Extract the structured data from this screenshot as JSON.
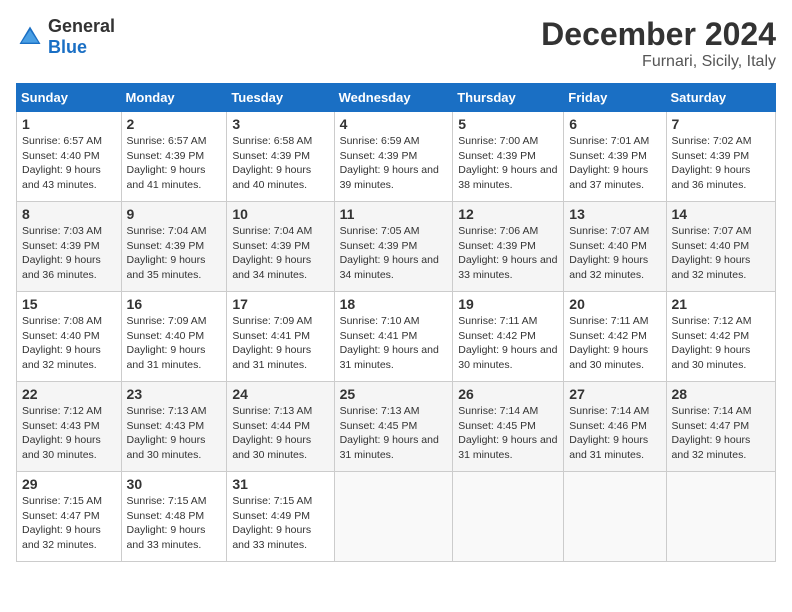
{
  "header": {
    "logo_general": "General",
    "logo_blue": "Blue",
    "title": "December 2024",
    "subtitle": "Furnari, Sicily, Italy"
  },
  "calendar": {
    "columns": [
      "Sunday",
      "Monday",
      "Tuesday",
      "Wednesday",
      "Thursday",
      "Friday",
      "Saturday"
    ],
    "rows": [
      [
        {
          "day": "1",
          "sunrise": "6:57 AM",
          "sunset": "4:40 PM",
          "daylight": "9 hours and 43 minutes."
        },
        {
          "day": "2",
          "sunrise": "6:57 AM",
          "sunset": "4:39 PM",
          "daylight": "9 hours and 41 minutes."
        },
        {
          "day": "3",
          "sunrise": "6:58 AM",
          "sunset": "4:39 PM",
          "daylight": "9 hours and 40 minutes."
        },
        {
          "day": "4",
          "sunrise": "6:59 AM",
          "sunset": "4:39 PM",
          "daylight": "9 hours and 39 minutes."
        },
        {
          "day": "5",
          "sunrise": "7:00 AM",
          "sunset": "4:39 PM",
          "daylight": "9 hours and 38 minutes."
        },
        {
          "day": "6",
          "sunrise": "7:01 AM",
          "sunset": "4:39 PM",
          "daylight": "9 hours and 37 minutes."
        },
        {
          "day": "7",
          "sunrise": "7:02 AM",
          "sunset": "4:39 PM",
          "daylight": "9 hours and 36 minutes."
        }
      ],
      [
        {
          "day": "8",
          "sunrise": "7:03 AM",
          "sunset": "4:39 PM",
          "daylight": "9 hours and 36 minutes."
        },
        {
          "day": "9",
          "sunrise": "7:04 AM",
          "sunset": "4:39 PM",
          "daylight": "9 hours and 35 minutes."
        },
        {
          "day": "10",
          "sunrise": "7:04 AM",
          "sunset": "4:39 PM",
          "daylight": "9 hours and 34 minutes."
        },
        {
          "day": "11",
          "sunrise": "7:05 AM",
          "sunset": "4:39 PM",
          "daylight": "9 hours and 34 minutes."
        },
        {
          "day": "12",
          "sunrise": "7:06 AM",
          "sunset": "4:39 PM",
          "daylight": "9 hours and 33 minutes."
        },
        {
          "day": "13",
          "sunrise": "7:07 AM",
          "sunset": "4:40 PM",
          "daylight": "9 hours and 32 minutes."
        },
        {
          "day": "14",
          "sunrise": "7:07 AM",
          "sunset": "4:40 PM",
          "daylight": "9 hours and 32 minutes."
        }
      ],
      [
        {
          "day": "15",
          "sunrise": "7:08 AM",
          "sunset": "4:40 PM",
          "daylight": "9 hours and 32 minutes."
        },
        {
          "day": "16",
          "sunrise": "7:09 AM",
          "sunset": "4:40 PM",
          "daylight": "9 hours and 31 minutes."
        },
        {
          "day": "17",
          "sunrise": "7:09 AM",
          "sunset": "4:41 PM",
          "daylight": "9 hours and 31 minutes."
        },
        {
          "day": "18",
          "sunrise": "7:10 AM",
          "sunset": "4:41 PM",
          "daylight": "9 hours and 31 minutes."
        },
        {
          "day": "19",
          "sunrise": "7:11 AM",
          "sunset": "4:42 PM",
          "daylight": "9 hours and 30 minutes."
        },
        {
          "day": "20",
          "sunrise": "7:11 AM",
          "sunset": "4:42 PM",
          "daylight": "9 hours and 30 minutes."
        },
        {
          "day": "21",
          "sunrise": "7:12 AM",
          "sunset": "4:42 PM",
          "daylight": "9 hours and 30 minutes."
        }
      ],
      [
        {
          "day": "22",
          "sunrise": "7:12 AM",
          "sunset": "4:43 PM",
          "daylight": "9 hours and 30 minutes."
        },
        {
          "day": "23",
          "sunrise": "7:13 AM",
          "sunset": "4:43 PM",
          "daylight": "9 hours and 30 minutes."
        },
        {
          "day": "24",
          "sunrise": "7:13 AM",
          "sunset": "4:44 PM",
          "daylight": "9 hours and 30 minutes."
        },
        {
          "day": "25",
          "sunrise": "7:13 AM",
          "sunset": "4:45 PM",
          "daylight": "9 hours and 31 minutes."
        },
        {
          "day": "26",
          "sunrise": "7:14 AM",
          "sunset": "4:45 PM",
          "daylight": "9 hours and 31 minutes."
        },
        {
          "day": "27",
          "sunrise": "7:14 AM",
          "sunset": "4:46 PM",
          "daylight": "9 hours and 31 minutes."
        },
        {
          "day": "28",
          "sunrise": "7:14 AM",
          "sunset": "4:47 PM",
          "daylight": "9 hours and 32 minutes."
        }
      ],
      [
        {
          "day": "29",
          "sunrise": "7:15 AM",
          "sunset": "4:47 PM",
          "daylight": "9 hours and 32 minutes."
        },
        {
          "day": "30",
          "sunrise": "7:15 AM",
          "sunset": "4:48 PM",
          "daylight": "9 hours and 33 minutes."
        },
        {
          "day": "31",
          "sunrise": "7:15 AM",
          "sunset": "4:49 PM",
          "daylight": "9 hours and 33 minutes."
        },
        null,
        null,
        null,
        null
      ]
    ]
  }
}
